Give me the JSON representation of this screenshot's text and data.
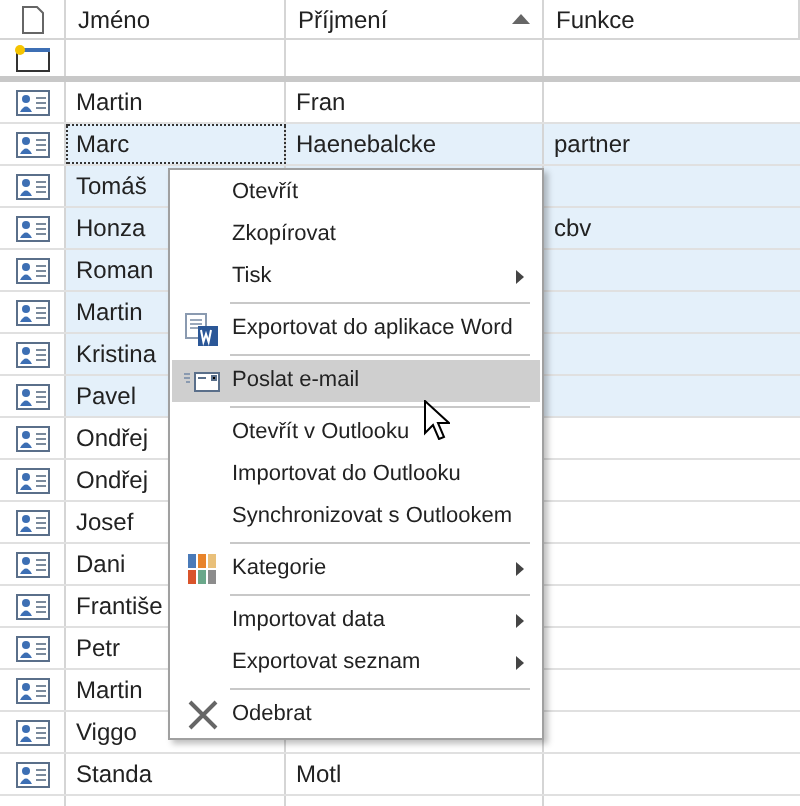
{
  "table": {
    "columns": [
      {
        "label": "Jméno",
        "sorted": false
      },
      {
        "label": "Příjmení",
        "sorted": true
      },
      {
        "label": "Funkce",
        "sorted": false
      }
    ],
    "rows": [
      {
        "first_name": "Martin",
        "last_name": "Fran",
        "function": "",
        "selected": false
      },
      {
        "first_name": "Marc",
        "last_name": "Haenebalcke",
        "function": "partner",
        "selected": true,
        "focused": true
      },
      {
        "first_name": "Tomáš",
        "last_name": "",
        "function": "",
        "selected": true
      },
      {
        "first_name": "Honza",
        "last_name": "",
        "function": "cbv",
        "selected": true
      },
      {
        "first_name": "Roman",
        "last_name": "",
        "function": "",
        "selected": true
      },
      {
        "first_name": "Martin",
        "last_name": "",
        "function": "",
        "selected": true
      },
      {
        "first_name": "Kristina",
        "last_name": "",
        "function": "",
        "selected": true
      },
      {
        "first_name": "Pavel",
        "last_name": "",
        "function": "",
        "selected": true
      },
      {
        "first_name": "Ondřej",
        "last_name": "",
        "function": "",
        "selected": false
      },
      {
        "first_name": "Ondřej",
        "last_name": "",
        "function": "",
        "selected": false
      },
      {
        "first_name": "Josef",
        "last_name": "",
        "function": "",
        "selected": false
      },
      {
        "first_name": "Dani",
        "last_name": "",
        "function": "",
        "selected": false
      },
      {
        "first_name": "Františe",
        "last_name": "",
        "function": "",
        "selected": false
      },
      {
        "first_name": "Petr",
        "last_name": "",
        "function": "",
        "selected": false
      },
      {
        "first_name": "Martin",
        "last_name": "",
        "function": "",
        "selected": false
      },
      {
        "first_name": "Viggo",
        "last_name": "",
        "function": "",
        "selected": false
      },
      {
        "first_name": "Standa",
        "last_name": "Motl",
        "function": "",
        "selected": false
      }
    ]
  },
  "context_menu": {
    "items": [
      {
        "kind": "plain",
        "label": "Otevřít",
        "submenu": false,
        "highlighted": false
      },
      {
        "kind": "plain",
        "label": "Zkopírovat",
        "submenu": false,
        "highlighted": false
      },
      {
        "kind": "plain",
        "label": "Tisk",
        "submenu": true,
        "highlighted": false
      },
      {
        "kind": "separator"
      },
      {
        "kind": "word",
        "label": "Exportovat do aplikace Word",
        "submenu": false,
        "highlighted": false
      },
      {
        "kind": "separator"
      },
      {
        "kind": "email",
        "label": "Poslat e-mail",
        "submenu": false,
        "highlighted": true
      },
      {
        "kind": "separator"
      },
      {
        "kind": "plain",
        "label": "Otevřít v Outlooku",
        "submenu": false,
        "highlighted": false
      },
      {
        "kind": "plain",
        "label": "Importovat do Outlooku",
        "submenu": false,
        "highlighted": false
      },
      {
        "kind": "plain",
        "label": "Synchronizovat s Outlookem",
        "submenu": false,
        "highlighted": false
      },
      {
        "kind": "separator"
      },
      {
        "kind": "category",
        "label": "Kategorie",
        "submenu": true,
        "highlighted": false
      },
      {
        "kind": "separator"
      },
      {
        "kind": "plain",
        "label": "Importovat data",
        "submenu": true,
        "highlighted": false
      },
      {
        "kind": "plain",
        "label": "Exportovat seznam",
        "submenu": true,
        "highlighted": false
      },
      {
        "kind": "separator"
      },
      {
        "kind": "remove",
        "label": "Odebrat",
        "submenu": false,
        "highlighted": false
      }
    ]
  }
}
